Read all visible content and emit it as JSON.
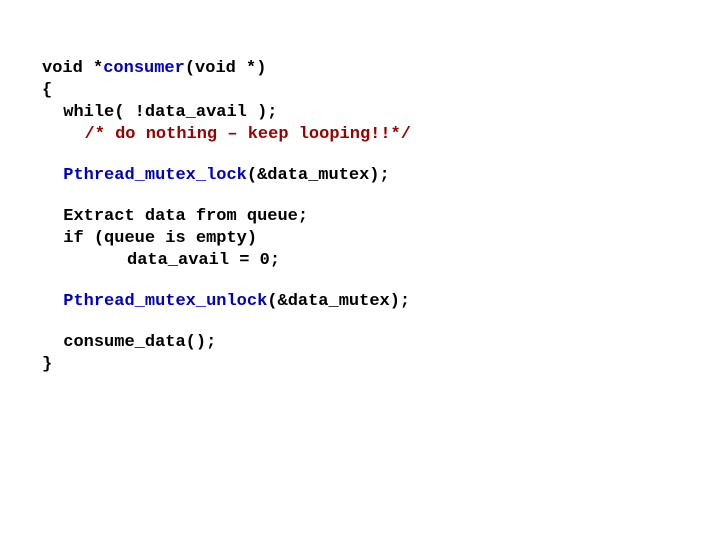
{
  "code": {
    "l1_a": "void *",
    "l1_b": "consumer",
    "l1_c": "(void *)",
    "l2": "{",
    "l3": "while( !data_avail );",
    "l4": "/* do nothing – keep looping!!*/",
    "l5": "Pthread_mutex_lock",
    "l5b": "(&data_mutex);",
    "l6": "Extract data from queue;",
    "l7": "if (queue is empty)",
    "l8": "data_avail = 0;",
    "l9": "Pthread_mutex_unlock",
    "l9b": "(&data_mutex);",
    "l10": "consume_data();",
    "l11": "}"
  }
}
